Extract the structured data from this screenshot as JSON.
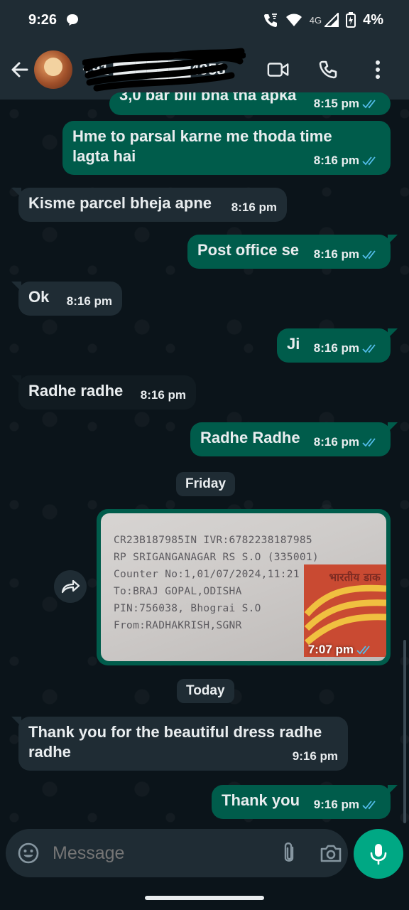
{
  "status_bar": {
    "time": "9:26",
    "network": "4G",
    "battery": "4%"
  },
  "app_bar": {
    "contact_name": "+91 ███████4958"
  },
  "messages": [
    {
      "dir": "out",
      "text": "3,0 bar bill bna tha apka",
      "time": "8:15 pm"
    },
    {
      "dir": "out",
      "text": "Hme to parsal karne me thoda time lagta hai",
      "time": "8:16 pm"
    },
    {
      "dir": "in",
      "text": "Kisme parcel bheja apne",
      "time": "8:16 pm"
    },
    {
      "dir": "out",
      "text": "Post office se",
      "time": "8:16 pm"
    },
    {
      "dir": "in",
      "text": "Ok",
      "time": "8:16 pm"
    },
    {
      "dir": "out",
      "text": "Ji",
      "time": "8:16 pm"
    },
    {
      "dir": "in",
      "text": "Radhe radhe",
      "time": "8:16 pm"
    },
    {
      "dir": "out",
      "text": "Radhe Radhe",
      "time": "8:16 pm"
    },
    {
      "dir": "out",
      "text": "Thank you",
      "time": "9:16 pm"
    },
    {
      "dir": "in",
      "text": "Thank you for the beautiful dress radhe radhe",
      "time": "9:16 pm"
    }
  ],
  "date_chips": {
    "friday": "Friday",
    "today": "Today"
  },
  "photo": {
    "time": "7:07 pm",
    "receipt_lines": [
      "CR23B187985IN IVR:6782238187985",
      "RP SRIGANGANAGAR RS S.O (335001)",
      "Counter No:1,01/07/2024,11:21",
      "To:BRAJ GOPAL,ODISHA",
      "PIN:756038, Bhograi S.O",
      "From:RADHAKRISH,SGNR"
    ],
    "stamp_text": "भारतीय डाक"
  },
  "composer": {
    "placeholder": "Message"
  },
  "colors": {
    "outgoing_bubble": "#005c4b",
    "incoming_bubble": "#1f2c34",
    "accent": "#00a884",
    "read_ticks": "#53bdeb"
  }
}
